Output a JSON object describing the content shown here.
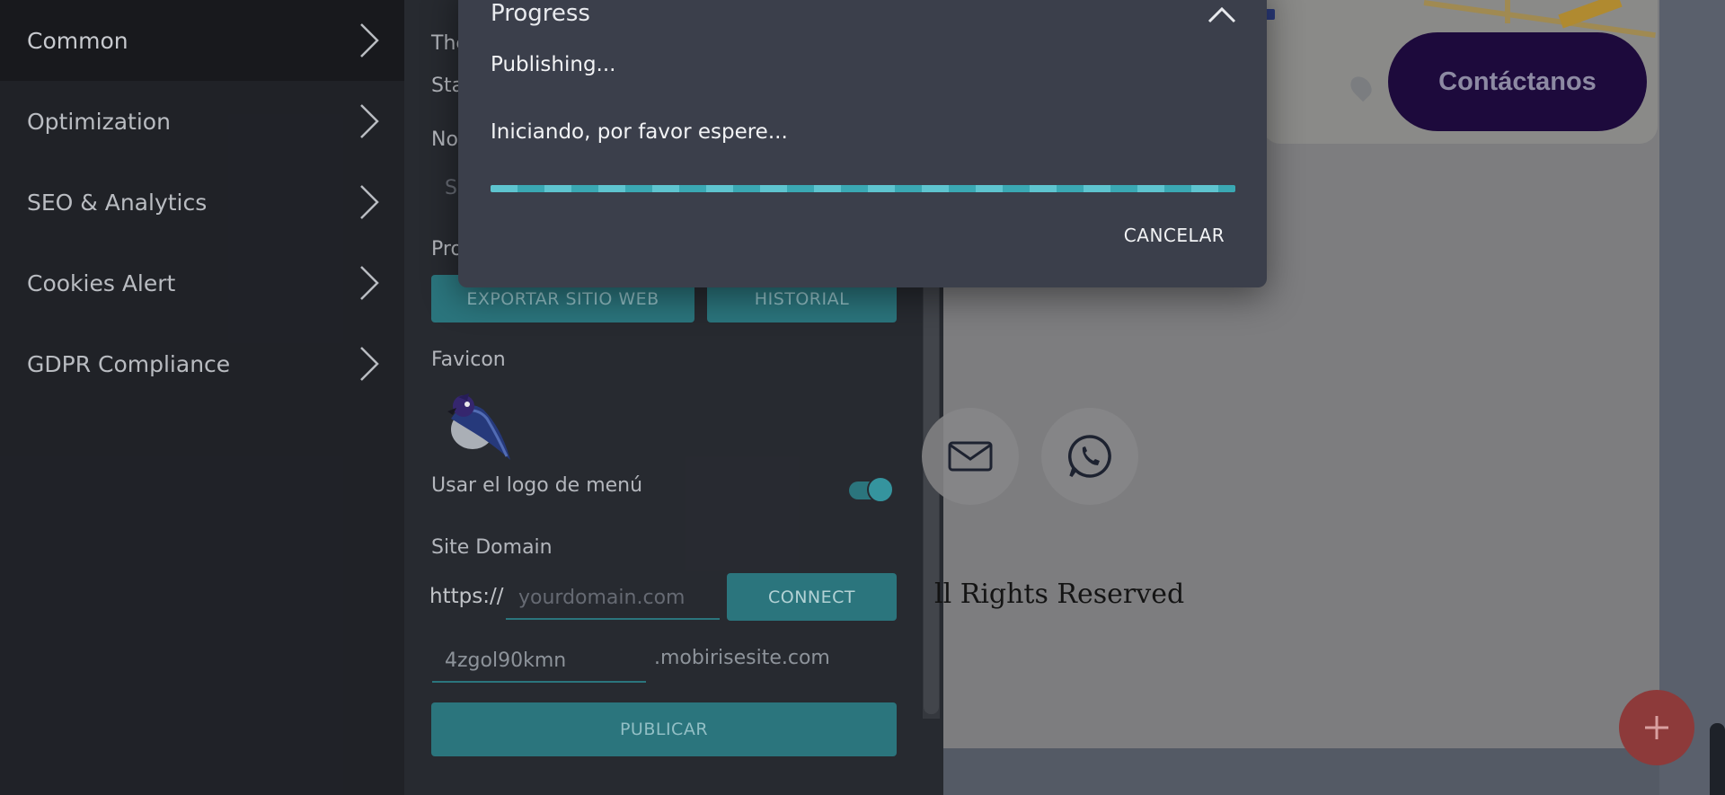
{
  "left_menu": {
    "items": [
      {
        "label": "Common"
      },
      {
        "label": "Optimization"
      },
      {
        "label": "SEO & Analytics"
      },
      {
        "label": "Cookies Alert"
      },
      {
        "label": "GDPR Compliance"
      }
    ]
  },
  "settings": {
    "label_the": "The",
    "label_sta": "Sta",
    "label_no": "No",
    "label_s": "S",
    "label_pro": "Pro",
    "export_button": "EXPORTAR SITIO WEB",
    "history_button": "HISTORIAL",
    "favicon_label": "Favicon",
    "use_menu_logo_label": "Usar el logo de menú",
    "use_menu_logo_on": true,
    "site_domain_label": "Site Domain",
    "protocol_prefix": "https://",
    "domain_placeholder": "yourdomain.com",
    "connect_button": "CONNECT",
    "subdomain_value": "4zgol90kmn",
    "subdomain_suffix": ".mobirisesite.com",
    "publish_button": "PUBLICAR"
  },
  "preview": {
    "contact_button": "Contáctanos",
    "rights_text": "ll Rights Reserved"
  },
  "dialog": {
    "title": "Progress",
    "status": "Publishing...",
    "message": "Iniciando, por favor espere...",
    "cancel_button": "CANCELAR"
  },
  "colors": {
    "accent": "#2f7f88",
    "panel": "#2b2e35",
    "menu": "#23252b",
    "dialog": "#3b3f4b",
    "contact_button": "#1d0a3c",
    "fab": "#8d3a3a"
  }
}
